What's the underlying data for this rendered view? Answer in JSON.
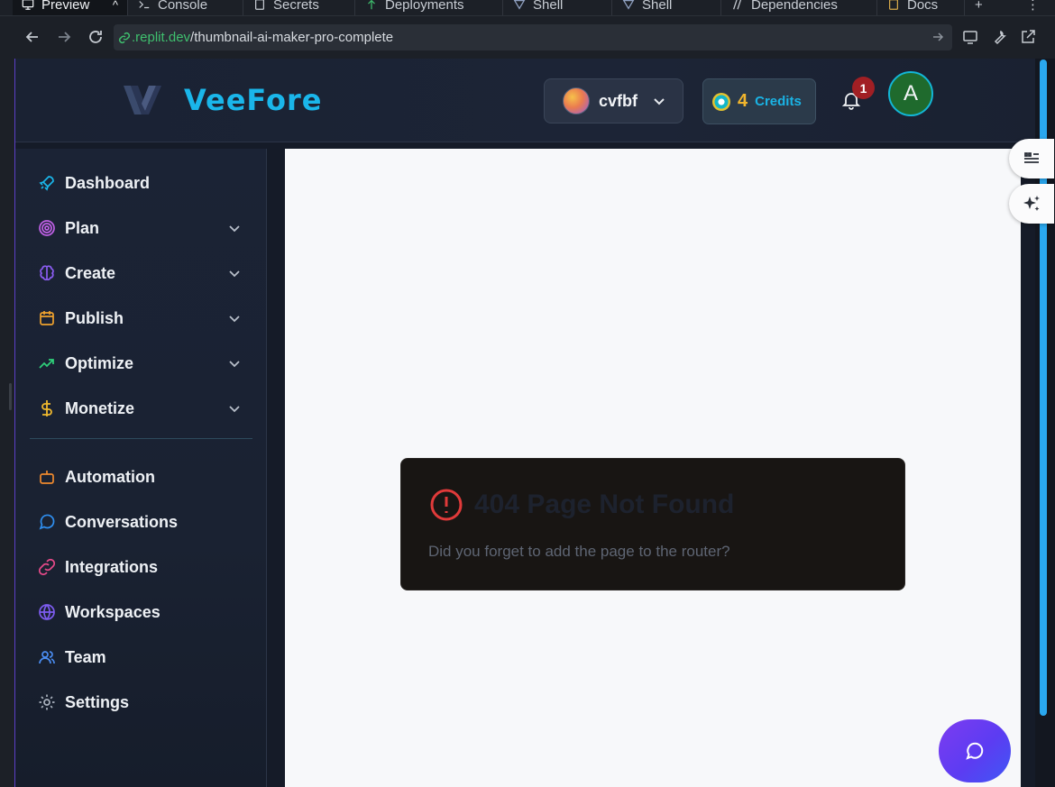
{
  "ide": {
    "tabs": [
      {
        "label": "Preview",
        "icon": "monitor-icon"
      },
      {
        "label": "Console",
        "icon": "terminal-icon"
      },
      {
        "label": "Secrets",
        "icon": "lock-icon"
      },
      {
        "label": "Deployments",
        "icon": "deploy-icon"
      },
      {
        "label": "Shell",
        "icon": "shell-icon"
      },
      {
        "label": "Shell",
        "icon": "shell-icon"
      },
      {
        "label": "Dependencies",
        "icon": "dependencies-icon"
      },
      {
        "label": "Docs",
        "icon": "docs-icon"
      }
    ],
    "url": {
      "host": ".replit.dev",
      "path": "/thumbnail-ai-maker-pro-complete"
    }
  },
  "app": {
    "brand": "VeeFore",
    "workspace": {
      "name": "cvfbf"
    },
    "credits": {
      "count": "4",
      "label": "Credits"
    },
    "notifications": {
      "count": "1"
    },
    "user": {
      "initial": "A"
    }
  },
  "sidebar": {
    "primary": [
      {
        "label": "Dashboard",
        "icon": "rocket-icon",
        "color": "#1ab6ea",
        "expandable": false
      },
      {
        "label": "Plan",
        "icon": "target-icon",
        "color": "#c061e6",
        "expandable": true
      },
      {
        "label": "Create",
        "icon": "brain-icon",
        "color": "#8a5cf0",
        "expandable": true
      },
      {
        "label": "Publish",
        "icon": "calendar-icon",
        "color": "#f0a22e",
        "expandable": true
      },
      {
        "label": "Optimize",
        "icon": "trending-up-icon",
        "color": "#2fd07a",
        "expandable": true
      },
      {
        "label": "Monetize",
        "icon": "dollar-icon",
        "color": "#f0b92e",
        "expandable": true
      }
    ],
    "secondary": [
      {
        "label": "Automation",
        "icon": "bot-icon",
        "color": "#f08a2e"
      },
      {
        "label": "Conversations",
        "icon": "message-circle-icon",
        "color": "#2f8ff0"
      },
      {
        "label": "Integrations",
        "icon": "link-icon",
        "color": "#e84a8a"
      },
      {
        "label": "Workspaces",
        "icon": "globe-icon",
        "color": "#7d5cf0"
      },
      {
        "label": "Team",
        "icon": "users-icon",
        "color": "#4a8cf0"
      },
      {
        "label": "Settings",
        "icon": "gear-icon",
        "color": "#aab2be"
      }
    ]
  },
  "error": {
    "title": "404 Page Not Found",
    "message": "Did you forget to add the page to the router?"
  },
  "colors": {
    "brand": "#1ab6ea",
    "error": "#e03a3a",
    "credits_count": "#f1b52d",
    "fab_gradient_start": "#7d3cf0",
    "fab_gradient_end": "#3f57f5"
  }
}
